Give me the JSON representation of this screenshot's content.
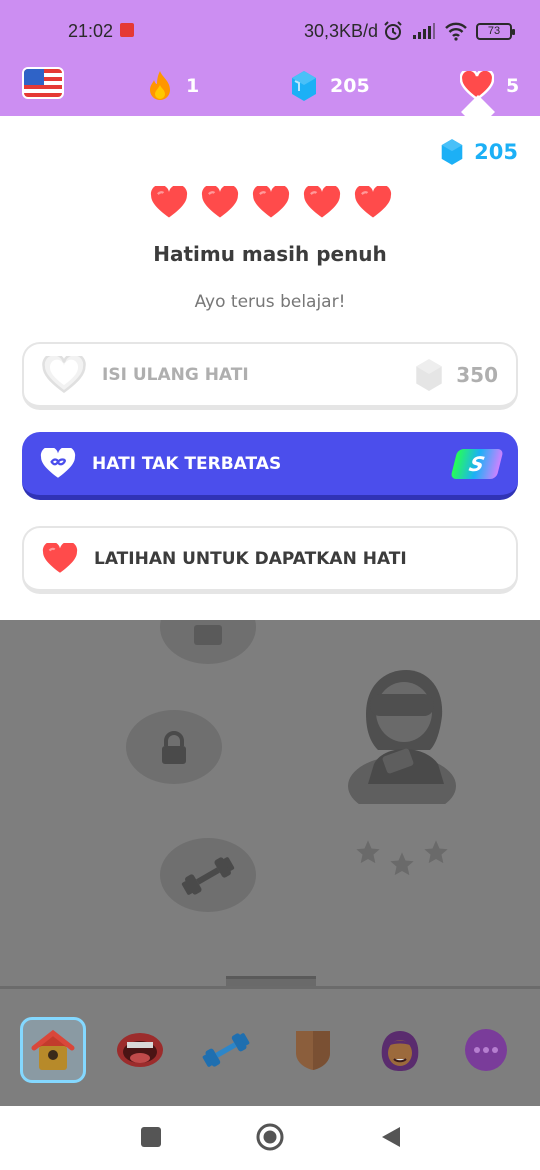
{
  "status_bar": {
    "time": "21:02",
    "network_speed": "30,3KB/d",
    "battery": "73",
    "icons": [
      "notification-icon",
      "alarm-icon",
      "signal-icon",
      "wifi-icon",
      "battery-icon"
    ]
  },
  "top_bar": {
    "language_flag": "us-flag-icon",
    "streak_count": "1",
    "gems_count": "205",
    "hearts_count": "5"
  },
  "hearts_panel": {
    "gems_balance": "205",
    "hearts_full": 5,
    "title": "Hatimu masih penuh",
    "subtitle": "Ayo terus belajar!",
    "options": {
      "refill_label": "ISI ULANG HATI",
      "refill_price": "350",
      "unlimited_label": "HATI TAK TERBATAS",
      "super_badge": "S",
      "practice_label": "LATIHAN UNTUK DAPATKAN HATI"
    }
  },
  "bottom_nav": {
    "items": [
      "home-icon",
      "speaking-icon",
      "practice-icon",
      "league-icon",
      "profile-icon",
      "more-icon"
    ],
    "active": "home-icon"
  },
  "colors": {
    "top_bar": "#cc8ef2",
    "gem_blue": "#1cb0f6",
    "heart_red": "#ff4b4b",
    "unlimited_button": "#4b4eec",
    "overlay_gray": "#7e7e7e"
  }
}
